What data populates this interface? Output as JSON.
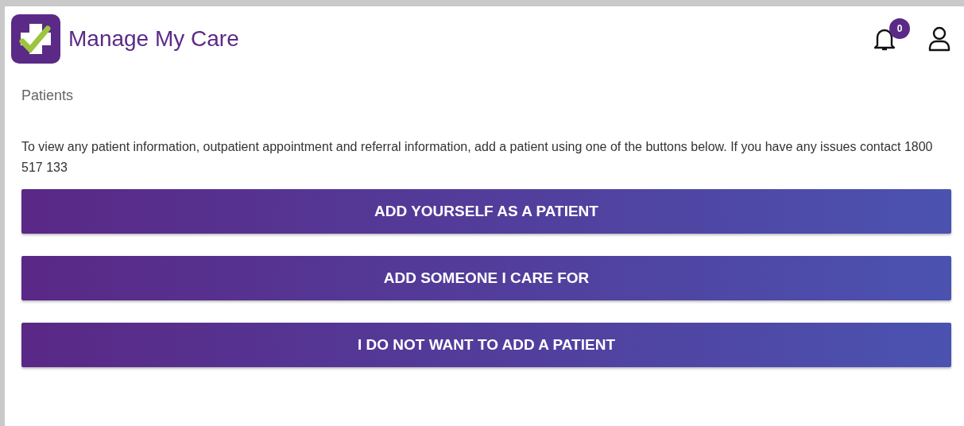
{
  "header": {
    "title": "Manage My Care",
    "notification_count": "0"
  },
  "page_title": "Patients",
  "intro": "To view any patient information, outpatient appointment and referral information, add a patient using one of the buttons below. If you have any issues contact 1800 517 133",
  "buttons": [
    {
      "label": "ADD YOURSELF AS A PATIENT"
    },
    {
      "label": "ADD SOMEONE I CARE FOR"
    },
    {
      "label": "I DO NOT WANT TO ADD A PATIENT"
    }
  ]
}
